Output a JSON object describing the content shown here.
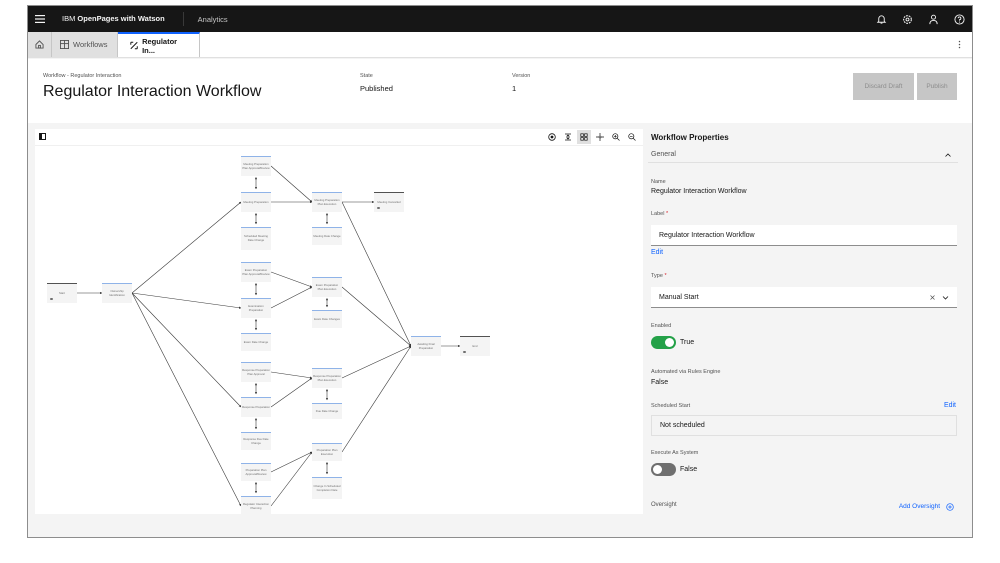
{
  "topbar": {
    "brand_prefix": "IBM ",
    "brand_name": "OpenPages with Watson",
    "nav_item": "Analytics",
    "icons": [
      "notification-icon",
      "settings-icon",
      "user-icon",
      "help-icon"
    ]
  },
  "tabs": {
    "home_icon": "home-icon",
    "items": [
      {
        "label": "Workflows",
        "icon": "table-icon"
      },
      {
        "label": "Regulator In...",
        "icon": "workflow-icon",
        "active": true
      }
    ]
  },
  "header": {
    "breadcrumb": "Workflow - Regulator Interaction",
    "title": "Regulator Interaction Workflow",
    "state_label": "State",
    "state_value": "Published",
    "version_label": "Version",
    "version_value": "1",
    "discard_label": "Discard Draft",
    "publish_label": "Publish"
  },
  "canvas": {
    "tools": [
      "center-icon",
      "align-icon",
      "grid-layout-icon",
      "fit-icon",
      "zoom-in-icon",
      "zoom-out-icon"
    ],
    "nodes": [
      {
        "id": "start",
        "label": "Start",
        "terminal": true
      },
      {
        "id": "ownership",
        "label": "Ownership Identification"
      },
      {
        "id": "mppa",
        "label": "Meeting Preparation Plan Approval/Review"
      },
      {
        "id": "mp",
        "label": "Meeting Preparation"
      },
      {
        "id": "smdc",
        "label": "Scheduled Meeting Date Change"
      },
      {
        "id": "mppe",
        "label": "Meeting Preparation Plan Execution"
      },
      {
        "id": "mdc",
        "label": "Meeting Date Change"
      },
      {
        "id": "mc",
        "label": "Meeting Cancelled",
        "terminal": true
      },
      {
        "id": "eppa",
        "label": "Exam Preparation Plan Approval/Review"
      },
      {
        "id": "ep",
        "label": "Examination Preparation"
      },
      {
        "id": "edc",
        "label": "Exam Date Change"
      },
      {
        "id": "eppe",
        "label": "Exam Preparation Plan Execution"
      },
      {
        "id": "edcs",
        "label": "Exam Date Changes"
      },
      {
        "id": "rppa",
        "label": "Response Preparation Plan Approval"
      },
      {
        "id": "rp",
        "label": "Response Preparation"
      },
      {
        "id": "rddc",
        "label": "Response Due Date Change"
      },
      {
        "id": "rppe",
        "label": "Response Preparation Plan Execution"
      },
      {
        "id": "ddc",
        "label": "Due Date Change"
      },
      {
        "id": "afp",
        "label": "Awaiting Final Preparation"
      },
      {
        "id": "end",
        "label": "End",
        "terminal": true
      },
      {
        "id": "ppa",
        "label": "Preparation Plan Approval/Review"
      },
      {
        "id": "rip",
        "label": "Regulator Interaction Planning"
      },
      {
        "id": "ppe",
        "label": "Preparation Plan Execution"
      },
      {
        "id": "csc",
        "label": "Change In Scheduled Completion Date"
      }
    ]
  },
  "properties": {
    "title": "Workflow Properties",
    "section": "General",
    "name_label": "Name",
    "name_value": "Regulator Interaction Workflow",
    "label_label": "Label",
    "required_mark": "*",
    "label_value": "Regulator Interaction Workflow",
    "edit_link": "Edit",
    "type_label": "Type",
    "type_value": "Manual Start",
    "enabled_label": "Enabled",
    "enabled_value": "True",
    "automated_label": "Automated via Rules Engine",
    "automated_value": "False",
    "scheduled_label": "Scheduled Start",
    "scheduled_edit": "Edit",
    "scheduled_value": "Not scheduled",
    "execute_label": "Execute As System",
    "execute_value": "False",
    "oversight_label": "Oversight",
    "add_oversight": "Add Oversight"
  }
}
